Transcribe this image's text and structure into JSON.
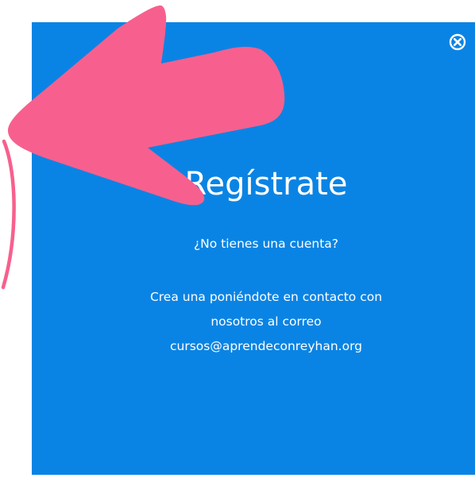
{
  "modal": {
    "title": "Regístrate",
    "subtitle": "¿No tienes una cuenta?",
    "body_line1": "Crea una poniéndote en contacto con",
    "body_line2": "nosotros al correo",
    "email": "cursos@aprendeconreyhan.org",
    "close_icon": "close-circle-icon"
  },
  "colors": {
    "panel_background": "#0a84e4",
    "text": "#ffffff",
    "annotation_arrow": "#f7608e"
  }
}
